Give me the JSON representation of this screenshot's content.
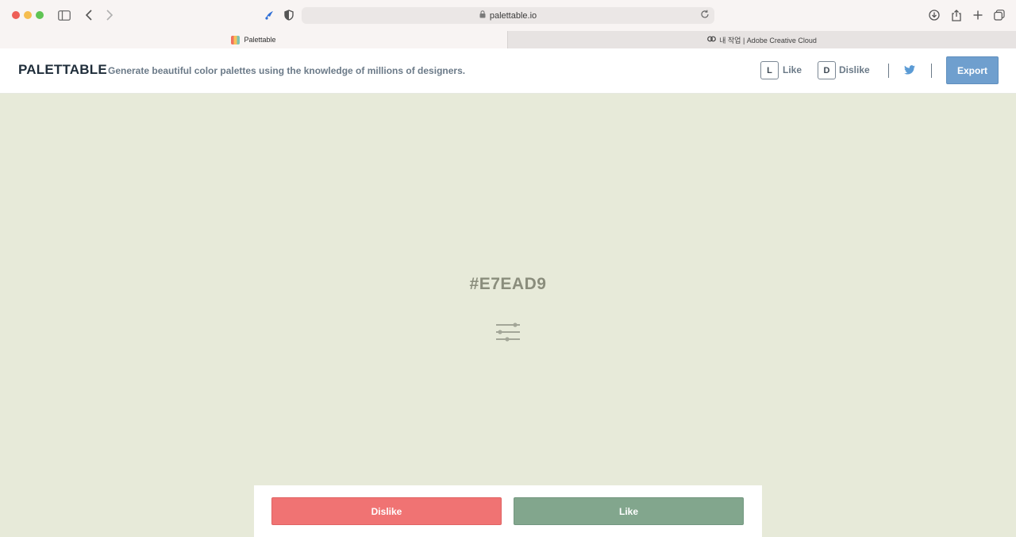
{
  "browser": {
    "url": "palettable.io",
    "tabs": [
      {
        "title": "Palettable",
        "active": true
      },
      {
        "title": "내 작업 | Adobe Creative Cloud",
        "active": false
      }
    ]
  },
  "header": {
    "logo": "PALETTABLE",
    "tagline": "Generate beautiful color palettes using the knowledge of millions of designers.",
    "like_key": "L",
    "like_label": "Like",
    "dislike_key": "D",
    "dislike_label": "Dislike",
    "export_label": "Export"
  },
  "swatch": {
    "hex": "#E7EAD9",
    "color": "#e7ead9"
  },
  "actions": {
    "dislike_label": "Dislike",
    "like_label": "Like"
  },
  "colors": {
    "dislike": "#f07373",
    "like": "#82a68d",
    "export": "#6f9fce",
    "twitter": "#5b9bd5"
  },
  "icons": [
    "sidebar-icon",
    "back-icon",
    "forward-icon",
    "extension-icon",
    "shield-icon",
    "lock-icon",
    "reload-icon",
    "download-icon",
    "share-icon",
    "new-tab-icon",
    "tab-overview-icon",
    "twitter-icon",
    "sliders-icon"
  ]
}
